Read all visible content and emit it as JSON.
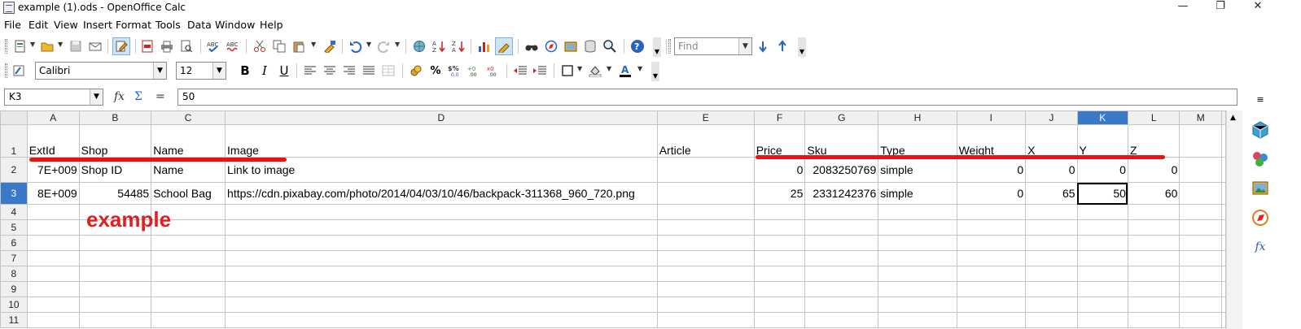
{
  "window": {
    "title": "example (1).ods - OpenOffice Calc",
    "minimize": "—",
    "maximize": "❐",
    "close": "✕"
  },
  "menu": [
    "File",
    "Edit",
    "View",
    "Insert",
    "Format",
    "Tools",
    "Data",
    "Window",
    "Help"
  ],
  "toolbar2": {
    "font_name": "Calibri",
    "font_size": "12",
    "bold": "B",
    "italic": "I",
    "underline": "U"
  },
  "find": {
    "placeholder": "Find"
  },
  "formula": {
    "name_box": "K3",
    "content": "50"
  },
  "sheet": {
    "columns": [
      "A",
      "B",
      "C",
      "D",
      "E",
      "F",
      "G",
      "H",
      "I",
      "J",
      "K",
      "L",
      "M"
    ],
    "rows": [
      [
        "ExtId",
        "Shop",
        "Name",
        "Image",
        "Article",
        "Price",
        "Sku",
        "Type",
        "Weight",
        "X",
        "Y",
        "Z",
        ""
      ],
      [
        "7E+009",
        "Shop ID",
        "Name",
        "Link to image",
        "",
        "0",
        "2083250769",
        "simple",
        "0",
        "0",
        "0",
        "0",
        ""
      ],
      [
        "8E+009",
        "54485",
        "School Bag",
        "https://cdn.pixabay.com/photo/2014/04/03/10/46/backpack-311368_960_720.png",
        "",
        "25",
        "2331242376",
        "simple",
        "0",
        "65",
        "50",
        "60",
        ""
      ],
      [
        "",
        "",
        "",
        "",
        "",
        "",
        "",
        "",
        "",
        "",
        "",
        "",
        ""
      ],
      [
        "",
        "",
        "",
        "",
        "",
        "",
        "",
        "",
        "",
        "",
        "",
        "",
        ""
      ],
      [
        "",
        "",
        "",
        "",
        "",
        "",
        "",
        "",
        "",
        "",
        "",
        "",
        ""
      ],
      [
        "",
        "",
        "",
        "",
        "",
        "",
        "",
        "",
        "",
        "",
        "",
        "",
        ""
      ],
      [
        "",
        "",
        "",
        "",
        "",
        "",
        "",
        "",
        "",
        "",
        "",
        "",
        ""
      ],
      [
        "",
        "",
        "",
        "",
        "",
        "",
        "",
        "",
        "",
        "",
        "",
        "",
        ""
      ],
      [
        "",
        "",
        "",
        "",
        "",
        "",
        "",
        "",
        "",
        "",
        "",
        "",
        ""
      ],
      [
        "",
        "",
        "",
        "",
        "",
        "",
        "",
        "",
        "",
        "",
        "",
        "",
        ""
      ]
    ],
    "row_numbers": [
      "1",
      "2",
      "3",
      "4",
      "5",
      "6",
      "7",
      "8",
      "9",
      "10",
      "11"
    ],
    "selected_cell": "K3"
  },
  "annotation": {
    "text": "example",
    "color": "#e02020"
  },
  "colors": {
    "selection": "#3a78c8",
    "annotation": "#e11111",
    "toolbar_active": "#cde4f7"
  }
}
